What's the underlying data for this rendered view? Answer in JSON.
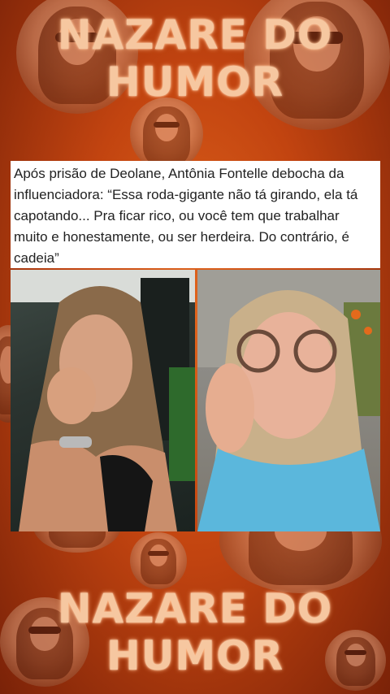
{
  "banner_top": {
    "line1": "NAZARE DO",
    "line2": "HUMOR"
  },
  "banner_bottom": {
    "line1": "NAZARE DO",
    "line2": "HUMOR"
  },
  "news_card": {
    "text": "Após prisão de Deolane, Antônia Fontelle debocha da influenciadora: “Essa roda-gigante não tá girando, ela tá capotando... Pra ficar rico, ou você tem que trabalhar muito e honestamente, ou ser herdeira. Do contrário, é cadeia”"
  },
  "colors": {
    "background": "#c24410",
    "title_text": "#f6c7a0",
    "card_bg": "#ffffff",
    "card_text": "#222222"
  }
}
